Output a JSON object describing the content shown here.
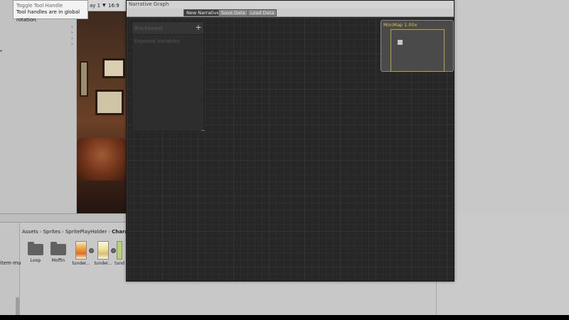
{
  "tooltip": {
    "line1": "Toggle Tool Handle Rotation",
    "line2": "Tool handles are in global rotation."
  },
  "game_toolbar": {
    "display": "ay 1",
    "dropdown_icon": "chevron-down-icon",
    "aspect": "16:9"
  },
  "graph": {
    "window_title": "Narrative Graph",
    "buttons": {
      "new_narrative": "New Narrative",
      "save_data": "Save Data",
      "load_data": "Load Data"
    },
    "blackboard": {
      "title": "Blackboard",
      "add_symbol": "+",
      "section": "Exposed Variables"
    },
    "minimap": {
      "label": "MiniMap  1.00x"
    }
  },
  "project": {
    "left_label": "item-mu",
    "breadcrumb": [
      "Assets",
      "Sprites",
      "SpritePlayHolder",
      "Characte"
    ],
    "assets": [
      {
        "type": "folder",
        "label": "Loop"
      },
      {
        "type": "folder",
        "label": "Moffin"
      },
      {
        "type": "sprite",
        "label": "tunder..."
      },
      {
        "type": "sprite",
        "label": "tunder..."
      },
      {
        "type": "sprite",
        "label": "tund"
      }
    ]
  },
  "colors": {
    "minimap_accent": "#d8c34a",
    "canvas_bg": "#272727",
    "editor_bg": "#c8c8c8"
  }
}
